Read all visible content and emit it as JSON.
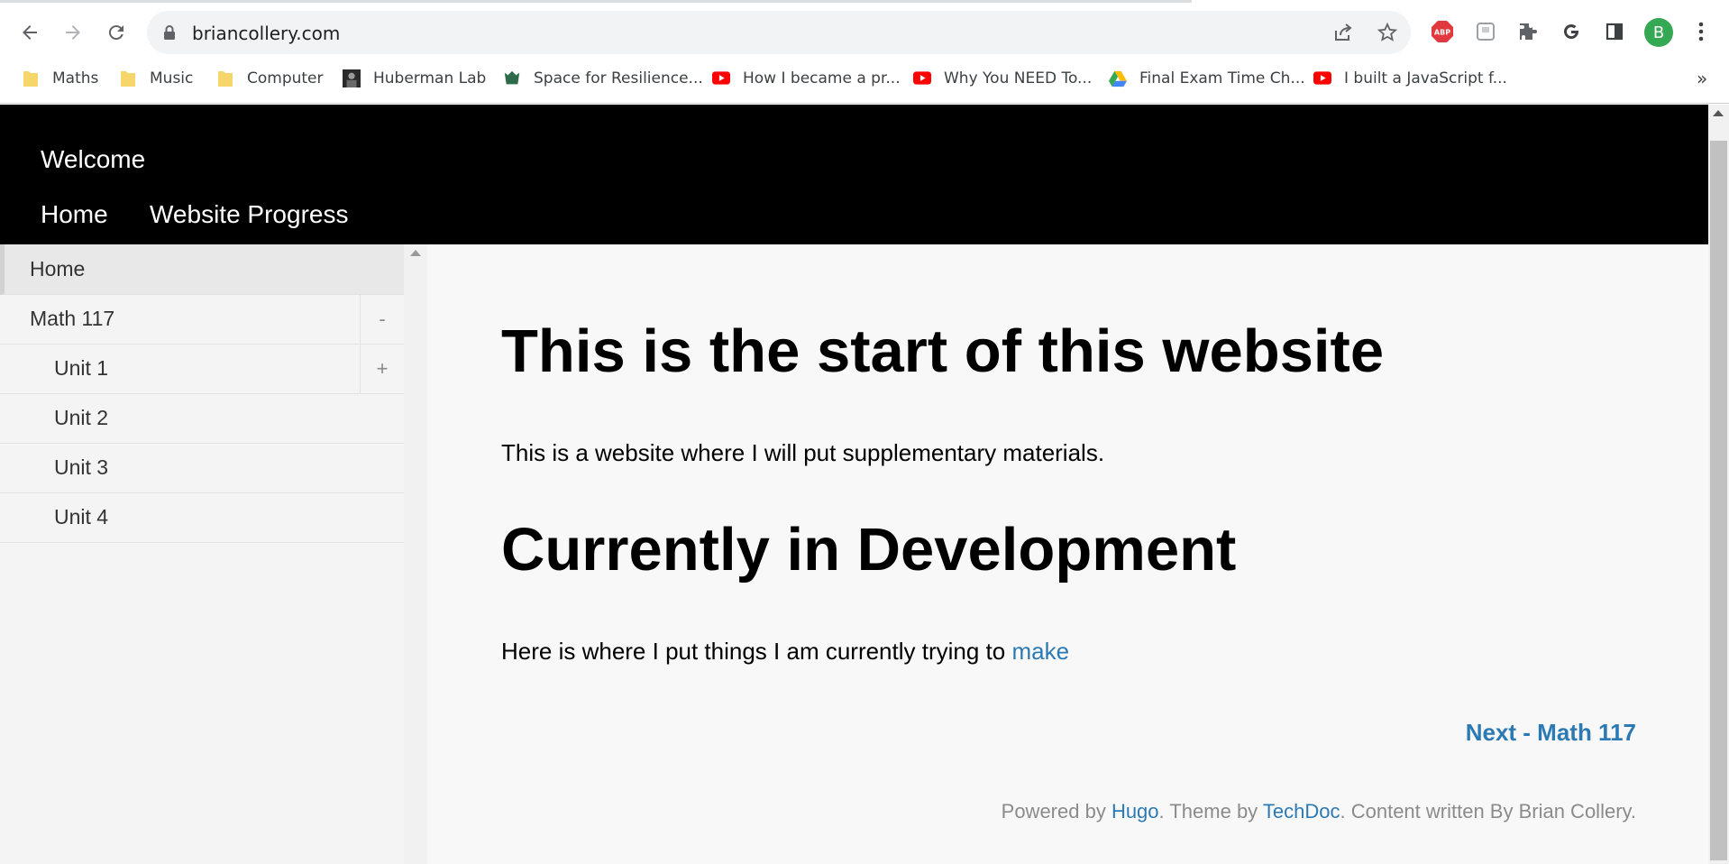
{
  "browser": {
    "url": "briancollery.com",
    "bookmarks": [
      {
        "label": "Maths",
        "icon": "folder-icon"
      },
      {
        "label": "Music",
        "icon": "folder-icon"
      },
      {
        "label": "Computer",
        "icon": "folder-icon"
      },
      {
        "label": "Huberman Lab",
        "icon": "podcast-favicon"
      },
      {
        "label": "Space for Resilience...",
        "icon": "site-favicon"
      },
      {
        "label": "How I became a pr...",
        "icon": "youtube-icon"
      },
      {
        "label": "Why You NEED To...",
        "icon": "youtube-icon"
      },
      {
        "label": "Final Exam Time Ch...",
        "icon": "google-drive-icon"
      },
      {
        "label": "I built a JavaScript f...",
        "icon": "youtube-icon"
      }
    ],
    "avatar_letter": "B",
    "more_bookmarks": "»"
  },
  "header": {
    "title": "Welcome",
    "nav": [
      {
        "label": "Home"
      },
      {
        "label": "Website Progress"
      }
    ]
  },
  "sidebar": {
    "items": [
      {
        "label": "Home",
        "active": true
      },
      {
        "label": "Math 117",
        "toggle": "-"
      },
      {
        "label": "Unit 1",
        "toggle": "+"
      },
      {
        "label": "Unit 2"
      },
      {
        "label": "Unit 3"
      },
      {
        "label": "Unit 4"
      }
    ]
  },
  "content": {
    "heading1": "This is the start of this website",
    "para1": "This is a website where I will put supplementary materials.",
    "heading2": "Currently in Development",
    "para2_text": "Here is where I put things I am currently trying to ",
    "para2_link": "make",
    "next_link": "Next - Math 117"
  },
  "footer": {
    "powered_by": "Powered by ",
    "hugo": "Hugo",
    "theme_by": ". Theme by ",
    "techdoc": "TechDoc",
    "written_by": ". Content written By Brian Collery."
  },
  "colors": {
    "header_bg": "#000000",
    "link": "#2c7ab4",
    "sidebar_bg": "#f4f4f4",
    "content_bg": "#f8f8f8"
  }
}
